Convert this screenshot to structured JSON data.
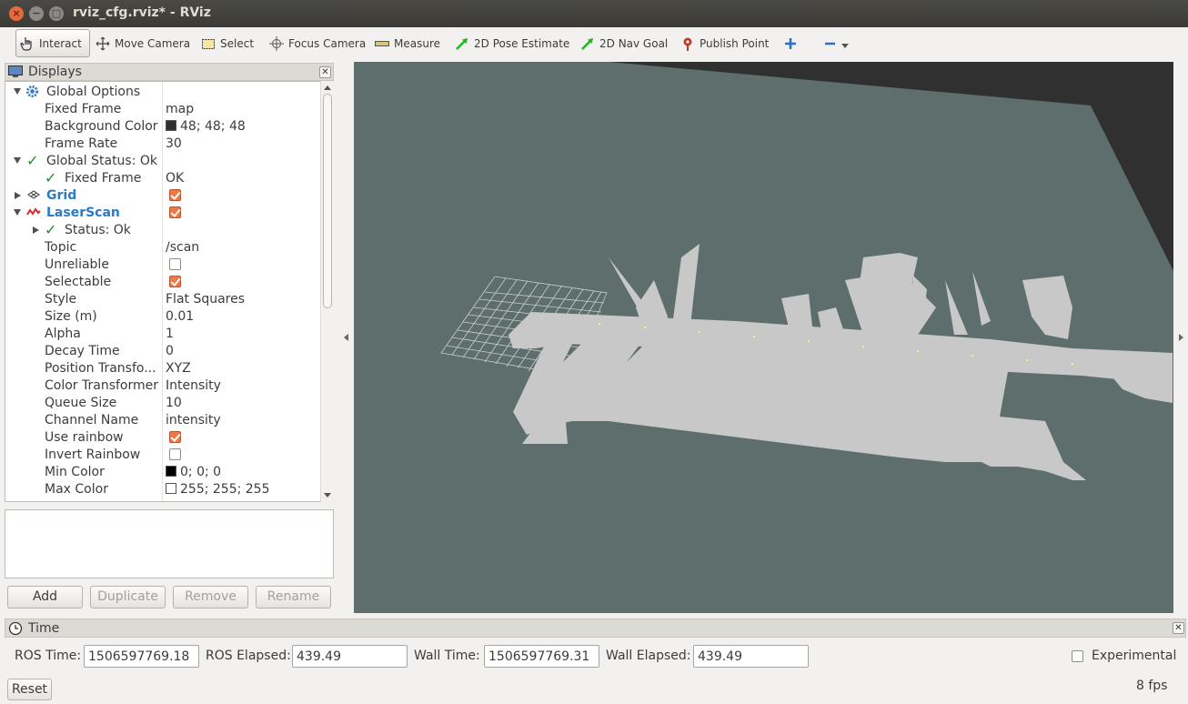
{
  "window": {
    "title": "rviz_cfg.rviz* - RViz"
  },
  "toolbar": {
    "tools": [
      {
        "label": "Interact",
        "icon": "hand-pointer-icon"
      },
      {
        "label": "Move Camera",
        "icon": "move-arrows-icon"
      },
      {
        "label": "Select",
        "icon": "select-rect-icon"
      },
      {
        "label": "Focus Camera",
        "icon": "crosshair-icon"
      },
      {
        "label": "Measure",
        "icon": "ruler-icon"
      },
      {
        "label": "2D Pose Estimate",
        "icon": "green-arrow-icon"
      },
      {
        "label": "2D Nav Goal",
        "icon": "green-arrow-icon"
      },
      {
        "label": "Publish Point",
        "icon": "map-pin-icon"
      }
    ]
  },
  "displays": {
    "title": "Displays",
    "rows": [
      {
        "label": "Global Options",
        "value": ""
      },
      {
        "label": "Fixed Frame",
        "value": "map"
      },
      {
        "label": "Background Color",
        "value": "48; 48; 48",
        "color": "#303030"
      },
      {
        "label": "Frame Rate",
        "value": "30"
      },
      {
        "label": "Global Status: Ok",
        "value": ""
      },
      {
        "label": "Fixed Frame",
        "value": "OK"
      },
      {
        "label": "Grid",
        "checked": true
      },
      {
        "label": "LaserScan",
        "checked": true
      },
      {
        "label": "Status: Ok",
        "value": ""
      },
      {
        "label": "Topic",
        "value": "/scan"
      },
      {
        "label": "Unreliable",
        "checked": false
      },
      {
        "label": "Selectable",
        "checked": true
      },
      {
        "label": "Style",
        "value": "Flat Squares"
      },
      {
        "label": "Size (m)",
        "value": "0.01"
      },
      {
        "label": "Alpha",
        "value": "1"
      },
      {
        "label": "Decay Time",
        "value": "0"
      },
      {
        "label": "Position Transfo...",
        "value": "XYZ"
      },
      {
        "label": "Color Transformer",
        "value": "Intensity"
      },
      {
        "label": "Queue Size",
        "value": "10"
      },
      {
        "label": "Channel Name",
        "value": "intensity"
      },
      {
        "label": "Use rainbow",
        "checked": true
      },
      {
        "label": "Invert Rainbow",
        "checked": false
      },
      {
        "label": "Min Color",
        "value": "0; 0; 0",
        "color": "#000000"
      },
      {
        "label": "Max Color",
        "value": "255; 255; 255",
        "color": "#ffffff"
      }
    ],
    "buttons": {
      "add": "Add",
      "duplicate": "Duplicate",
      "remove": "Remove",
      "rename": "Rename"
    }
  },
  "time": {
    "title": "Time",
    "ros_time_label": "ROS Time:",
    "ros_time": "1506597769.18",
    "ros_elapsed_label": "ROS Elapsed:",
    "ros_elapsed": "439.49",
    "wall_time_label": "Wall Time:",
    "wall_time": "1506597769.31",
    "wall_elapsed_label": "Wall Elapsed:",
    "wall_elapsed": "439.49",
    "experimental_label": "Experimental",
    "reset_label": "Reset",
    "fps": "8 fps"
  },
  "colors": {
    "view_background": "#303030",
    "ground_plane": "#5d6e6c",
    "scan_points": "#c8c8c8",
    "accent_orange": "#f07746"
  }
}
